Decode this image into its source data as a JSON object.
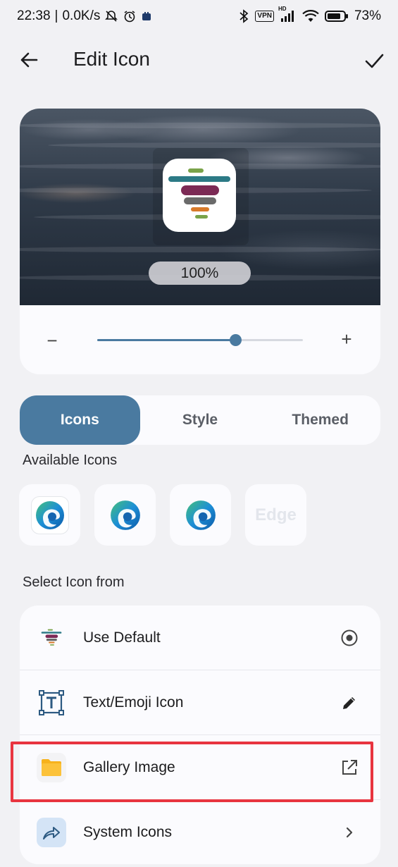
{
  "status_bar": {
    "time": "22:38",
    "network_speed": "0.0K/s",
    "vpn_label": "VPN",
    "hd_label": "HD",
    "battery": "73%"
  },
  "app_bar": {
    "title": "Edit Icon",
    "back_icon": "arrow-left-icon",
    "confirm_icon": "check-icon"
  },
  "preview": {
    "zoom_label": "100%",
    "slider_value_percent": 67
  },
  "tabs": [
    {
      "label": "Icons",
      "active": true
    },
    {
      "label": "Style",
      "active": false
    },
    {
      "label": "Themed",
      "active": false
    }
  ],
  "available_icons": {
    "heading": "Available Icons",
    "items": [
      {
        "icon": "edge-icon"
      },
      {
        "icon": "edge-icon"
      },
      {
        "icon": "edge-icon"
      },
      {
        "text": "Edge"
      }
    ]
  },
  "select_from": {
    "heading": "Select Icon from",
    "items": [
      {
        "label": "Use Default",
        "icon": "app-default-icon",
        "trailing": "radio-selected-icon"
      },
      {
        "label": "Text/Emoji Icon",
        "icon": "text-box-icon",
        "trailing": "pencil-icon"
      },
      {
        "label": "Gallery Image",
        "icon": "folder-icon",
        "trailing": "open-external-icon"
      },
      {
        "label": "System Icons",
        "icon": "share-arrow-icon",
        "trailing": "chevron-right-icon"
      }
    ]
  },
  "colors": {
    "accent": "#4a7aa0",
    "highlight": "#e8343f",
    "background": "#f1f1f4"
  }
}
